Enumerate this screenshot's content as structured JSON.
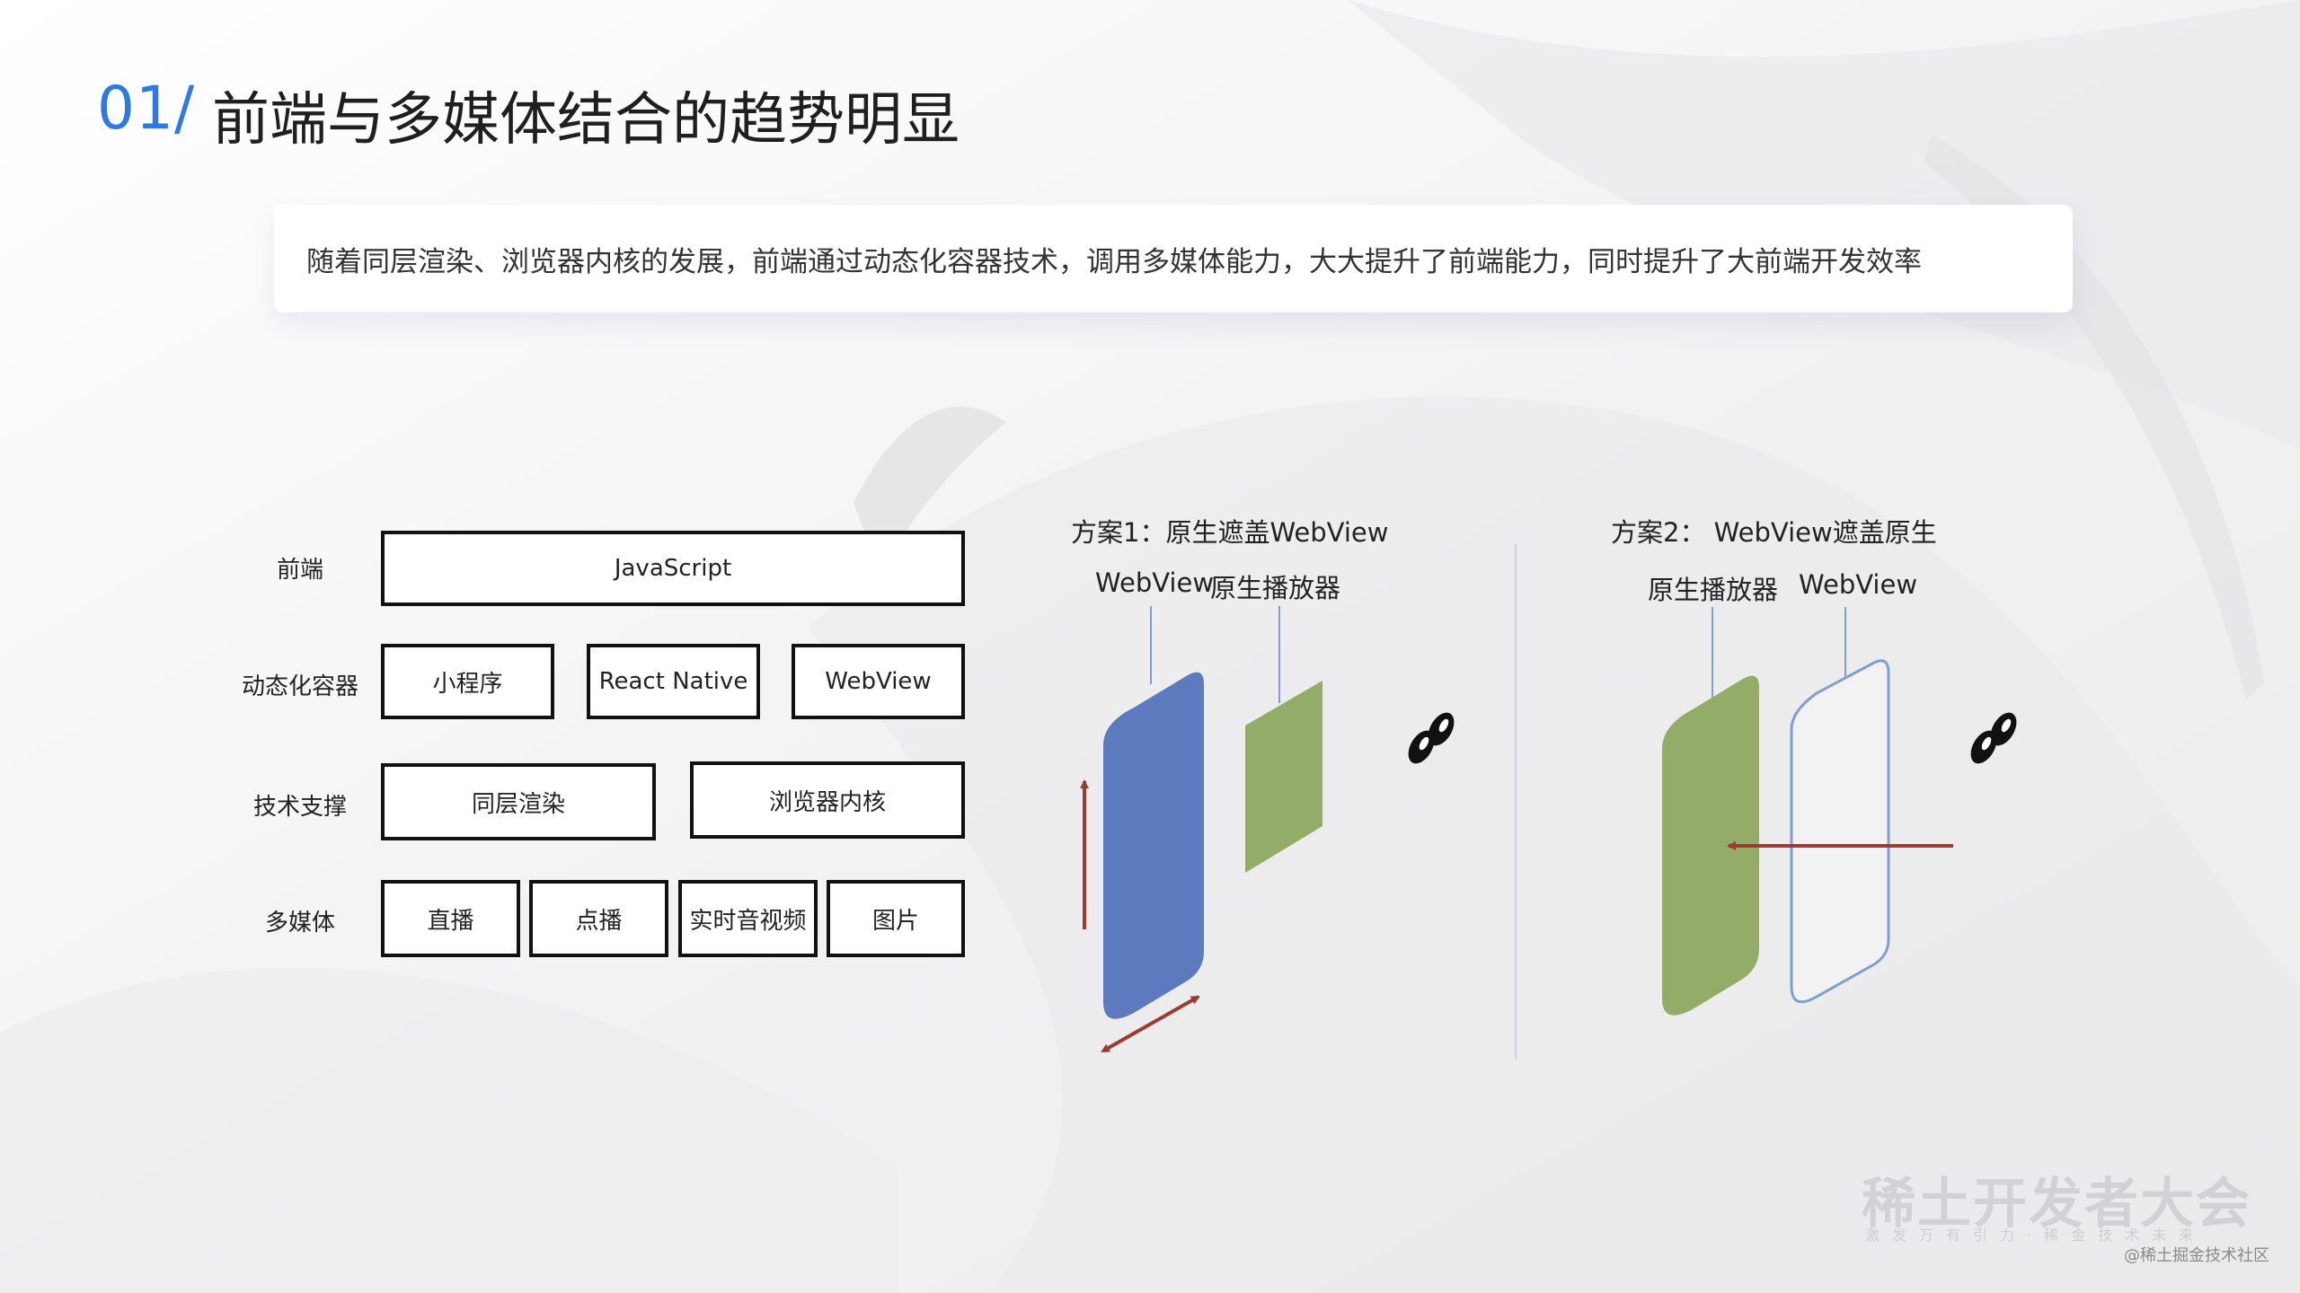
{
  "title": {
    "number": "01/",
    "text": "前端与多媒体结合的趋势明显"
  },
  "intro": "随着同层渲染、浏览器内核的发展，前端通过动态化容器技术，调用多媒体能力，大大提升了前端能力，同时提升了大前端开发效率",
  "stack": {
    "rows": [
      {
        "label": "前端",
        "boxes": [
          "JavaScript"
        ]
      },
      {
        "label": "动态化容器",
        "boxes": [
          "小程序",
          "React Native",
          "WebView"
        ]
      },
      {
        "label": "技术支撑",
        "boxes": [
          "同层渲染",
          "浏览器内核"
        ]
      },
      {
        "label": "多媒体",
        "boxes": [
          "直播",
          "点播",
          "实时音视频",
          "图片"
        ]
      }
    ]
  },
  "plan1": {
    "title": "方案1：原生遮盖WebView",
    "label_a": "WebView",
    "label_b": "原生播放器"
  },
  "plan2": {
    "title": "方案2： WebView遮盖原生",
    "label_a": "原生播放器",
    "label_b": "WebView"
  },
  "colors": {
    "accent": "#2f7ae0",
    "blue_layer": "#5e7abf",
    "green_layer": "#93ac67",
    "arrow": "#9b3b32"
  },
  "icons": [
    "eye-icon",
    "eye-icon"
  ],
  "logo": {
    "main": "稀土开发者大会",
    "sub": "激发万有引力·稀金技术未来"
  },
  "watermark": "@稀土掘金技术社区"
}
